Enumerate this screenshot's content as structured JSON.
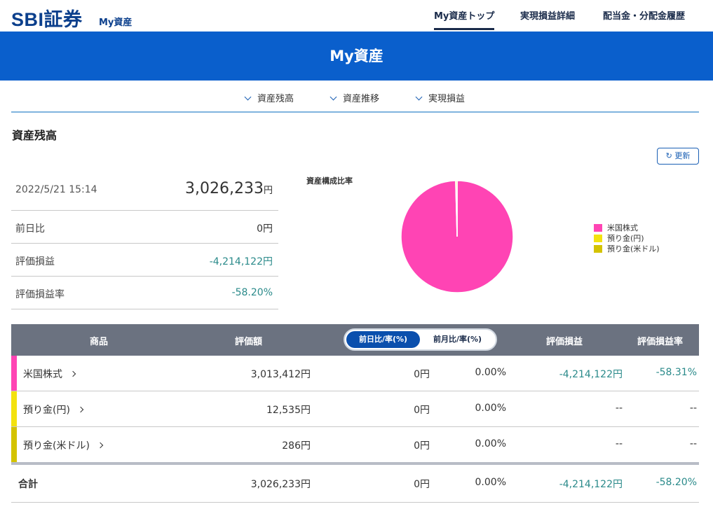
{
  "header": {
    "logo": "SBI証券",
    "logo_sub": "My資産",
    "nav": [
      "My資産トップ",
      "実現損益詳細",
      "配当金・分配金履歴"
    ]
  },
  "banner": {
    "title": "My資産"
  },
  "anchors": [
    "資産残高",
    "資産推移",
    "実現損益"
  ],
  "section": {
    "title": "資産残高",
    "refresh": "↻ 更新"
  },
  "summary": {
    "datetime": "2022/5/21 15:14",
    "total": "3,026,233",
    "total_unit": "円",
    "rows": [
      {
        "label": "前日比",
        "value": "0円"
      },
      {
        "label": "評価損益",
        "value": "-4,214,122円"
      },
      {
        "label": "評価損益率",
        "value": "-58.20%"
      }
    ]
  },
  "chart_data": {
    "type": "pie",
    "title": "資産構成比率",
    "labels": [
      "米国株式",
      "預り金(円)",
      "預り金(米ドル)"
    ],
    "values": [
      3013412,
      12535,
      286
    ],
    "colors": [
      "#ff44b4",
      "#f3e20f",
      "#d4c300"
    ],
    "legend_position": "right"
  },
  "table": {
    "headers": {
      "product": "商品",
      "valuation": "評価額",
      "toggle_on": "前日比/率(%)",
      "toggle_off": "前月比/率(%)",
      "pl": "評価損益",
      "pl_rate": "評価損益率"
    },
    "rows": [
      {
        "name": "米国株式",
        "color": "#ff44b4",
        "valuation": "3,013,412円",
        "diff": "0円",
        "rate": "0.00%",
        "pl": "-4,214,122円",
        "pl_rate": "-58.31%"
      },
      {
        "name": "預り金(円)",
        "color": "#f3e20f",
        "valuation": "12,535円",
        "diff": "0円",
        "rate": "0.00%",
        "pl": "--",
        "pl_rate": "--"
      },
      {
        "name": "預り金(米ドル)",
        "color": "#d4c300",
        "valuation": "286円",
        "diff": "0円",
        "rate": "0.00%",
        "pl": "--",
        "pl_rate": "--"
      }
    ],
    "total": {
      "name": "合計",
      "valuation": "3,026,233円",
      "diff": "0円",
      "rate": "0.00%",
      "pl": "-4,214,122円",
      "pl_rate": "-58.20%"
    }
  }
}
